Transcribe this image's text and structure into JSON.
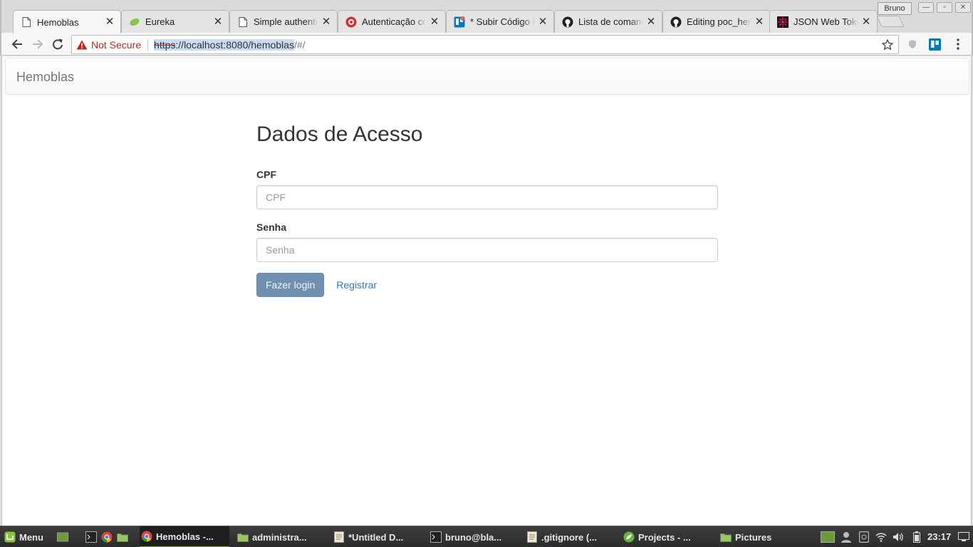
{
  "browser": {
    "profile_name": "Bruno",
    "tabs": [
      {
        "title": "Hemoblas",
        "icon": "page-icon"
      },
      {
        "title": "Eureka",
        "icon": "leaf-icon"
      },
      {
        "title": "Simple authentic",
        "icon": "page-icon"
      },
      {
        "title": "Autenticação co",
        "icon": "avatar-icon"
      },
      {
        "title": "* Subir Código F",
        "icon": "trello-icon"
      },
      {
        "title": "Lista de comand",
        "icon": "github-icon"
      },
      {
        "title": "Editing poc_hem",
        "icon": "github-icon"
      },
      {
        "title": "JSON Web Token",
        "icon": "jwt-icon"
      }
    ],
    "security_label": "Not Secure",
    "url": {
      "scheme": "https",
      "rest_selected": "://localhost:8080/hemoblas",
      "rest_unselected": "/#/"
    }
  },
  "page": {
    "brand": "Hemoblas",
    "heading": "Dados de Acesso",
    "cpf": {
      "label": "CPF",
      "placeholder": "CPF",
      "value": ""
    },
    "senha": {
      "label": "Senha",
      "placeholder": "Senha",
      "value": ""
    },
    "login_button": "Fazer login",
    "register_link": "Registrar"
  },
  "taskbar": {
    "menu_label": "Menu",
    "windows": [
      {
        "label": "Hemoblas -...",
        "icon": "chrome-icon",
        "active": true
      },
      {
        "label": "administra...",
        "icon": "folder-icon"
      },
      {
        "label": "*Untitled D...",
        "icon": "text-editor-icon"
      },
      {
        "label": "bruno@bla...",
        "icon": "terminal-icon"
      },
      {
        "label": ".gitignore (...",
        "icon": "text-editor-icon"
      },
      {
        "label": "Projects - ...",
        "icon": "spring-icon"
      },
      {
        "label": "Pictures",
        "icon": "folder-icon"
      }
    ],
    "clock": "23:17"
  },
  "colors": {
    "accent_link": "#337ab7",
    "login_button_bg": "#6f90b0",
    "warning_red": "#c5221f",
    "taskbar_accent": "#7bb03a"
  }
}
